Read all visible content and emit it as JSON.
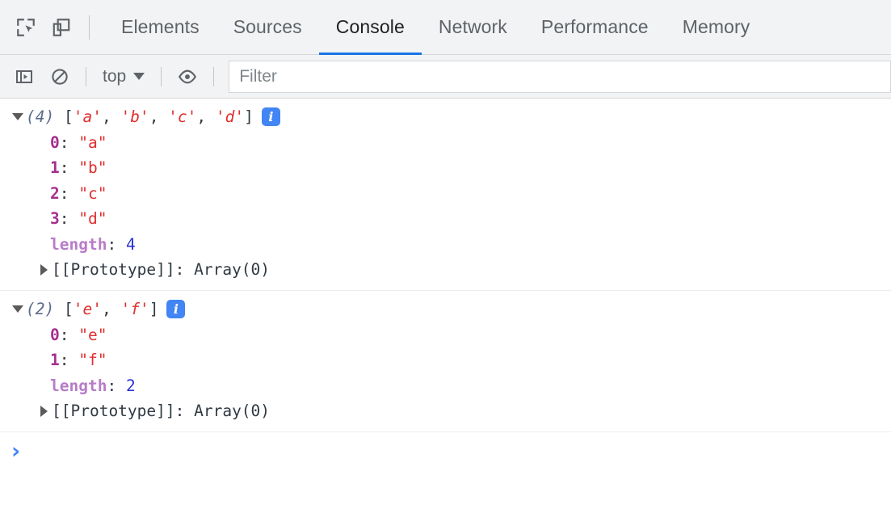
{
  "tabbar": {
    "inspect_icon": "inspect-element-icon",
    "device_icon": "device-toolbar-icon",
    "tabs": [
      {
        "label": "Elements",
        "active": false
      },
      {
        "label": "Sources",
        "active": false
      },
      {
        "label": "Console",
        "active": true
      },
      {
        "label": "Network",
        "active": false
      },
      {
        "label": "Performance",
        "active": false
      },
      {
        "label": "Memory",
        "active": false
      }
    ]
  },
  "console_toolbar": {
    "sidebar_icon": "console-sidebar-icon",
    "clear_icon": "clear-console-icon",
    "context_label": "top",
    "caret_icon": "chevron-down-icon",
    "eye_icon": "live-expression-eye-icon",
    "filter_placeholder": "Filter",
    "filter_value": ""
  },
  "console_entries": [
    {
      "expanded": true,
      "count": "(4)",
      "preview_open": "[",
      "preview_items": [
        "'a'",
        "'b'",
        "'c'",
        "'d'"
      ],
      "preview_close": "]",
      "preview_sep": ", ",
      "info_badge": "i",
      "properties": [
        {
          "key": "0",
          "value": "\"a\"",
          "kind": "index"
        },
        {
          "key": "1",
          "value": "\"b\"",
          "kind": "index"
        },
        {
          "key": "2",
          "value": "\"c\"",
          "kind": "index"
        },
        {
          "key": "3",
          "value": "\"d\"",
          "kind": "index"
        },
        {
          "key": "length",
          "value": "4",
          "kind": "number"
        }
      ],
      "prototype_key": "[[Prototype]]",
      "prototype_value": "Array(0)"
    },
    {
      "expanded": true,
      "count": "(2)",
      "preview_open": "[",
      "preview_items": [
        "'e'",
        "'f'"
      ],
      "preview_close": "]",
      "preview_sep": ", ",
      "info_badge": "i",
      "properties": [
        {
          "key": "0",
          "value": "\"e\"",
          "kind": "index"
        },
        {
          "key": "1",
          "value": "\"f\"",
          "kind": "index"
        },
        {
          "key": "length",
          "value": "2",
          "kind": "number"
        }
      ],
      "prototype_key": "[[Prototype]]",
      "prototype_value": "Array(0)"
    }
  ],
  "prompt": {
    "chevron": "›",
    "value": "",
    "placeholder": ""
  },
  "colors": {
    "accent": "#1a73e8",
    "info_badge": "#4285f4",
    "toolbar_bg": "#f1f3f4",
    "string": "#e02f2f",
    "index": "#a4308f",
    "property": "#b77cc7",
    "number": "#2b32d4"
  }
}
